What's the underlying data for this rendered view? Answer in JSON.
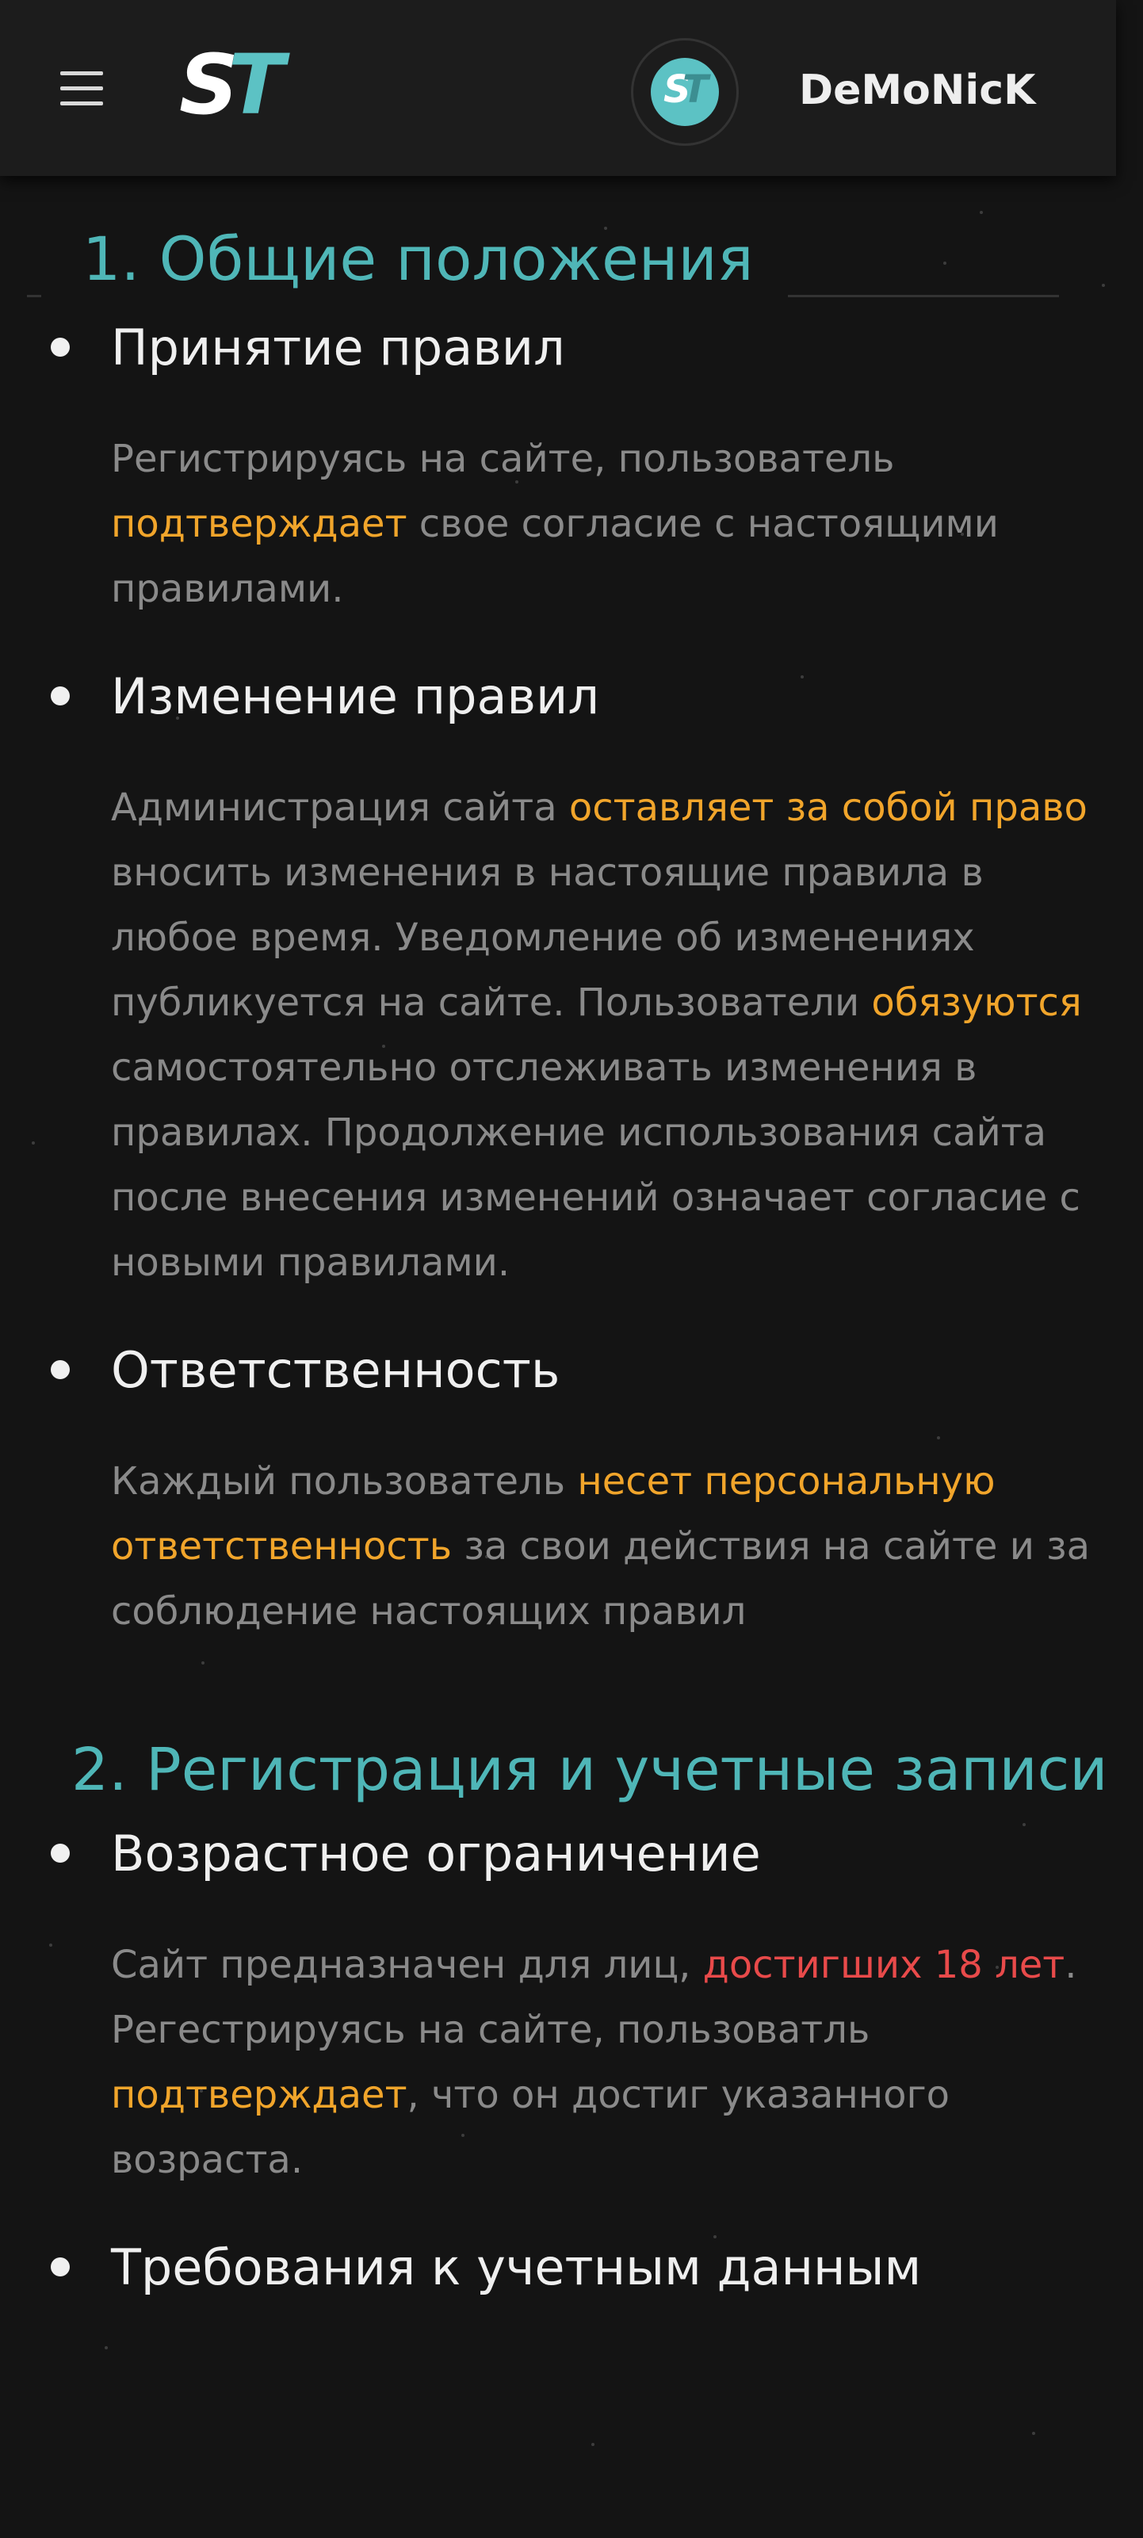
{
  "header": {
    "logo": {
      "s": "S",
      "t": "T"
    },
    "avatar": {
      "s": "S",
      "t": "T"
    },
    "username": "DeMoNicK"
  },
  "colors": {
    "background": "#141414",
    "header": "#1c1c1c",
    "accent": "#4fb6b7",
    "highlight": "#f1a52b",
    "warning": "#e84a4a",
    "text": "#8a8a8a",
    "heading": "#efefef"
  },
  "icons": {
    "menu": "hamburger-menu-icon"
  },
  "sections": [
    {
      "title": "1. Общие положения",
      "rules": [
        {
          "title": "Принятие правил",
          "text": [
            {
              "t": "Регистрируясь на сайте, пользователь ",
              "s": "plain"
            },
            {
              "t": "подтверждает",
              "s": "hl"
            },
            {
              "t": " свое согласие с настоящими правилами.",
              "s": "plain"
            }
          ]
        },
        {
          "title": "Изменение правил",
          "text": [
            {
              "t": "Администрация сайта ",
              "s": "plain"
            },
            {
              "t": "оставляет за собой право",
              "s": "hl"
            },
            {
              "t": " вносить изменения в настоящие правила в любое время. Уведомление об изменениях публикуется на сайте. Пользователи ",
              "s": "plain"
            },
            {
              "t": "обязуются",
              "s": "hl"
            },
            {
              "t": " самостоятельно отслеживать изменения в правилах. Продолжение использования сайта после внесения изменений означает согласие с новыми правилами.",
              "s": "plain"
            }
          ]
        },
        {
          "title": "Ответственность",
          "text": [
            {
              "t": "Каждый пользователь ",
              "s": "plain"
            },
            {
              "t": "несет персональную ответственность",
              "s": "hl"
            },
            {
              "t": " за свои действия на сайте и за соблюдение настоящих правил",
              "s": "plain"
            }
          ]
        }
      ]
    },
    {
      "title": "2. Регистрация и учетные записи",
      "rules": [
        {
          "title": "Возрастное ограничение",
          "text": [
            {
              "t": "Сайт предназначен для лиц, ",
              "s": "plain"
            },
            {
              "t": "достигших 18 лет",
              "s": "hl-red"
            },
            {
              "t": ". Регестрируясь на сайте, пользоватль ",
              "s": "plain"
            },
            {
              "t": "подтверждает",
              "s": "hl"
            },
            {
              "t": ", что он достиг указанного возраста.",
              "s": "plain"
            }
          ]
        },
        {
          "title": "Требования к учетным данным",
          "text": []
        }
      ]
    }
  ]
}
